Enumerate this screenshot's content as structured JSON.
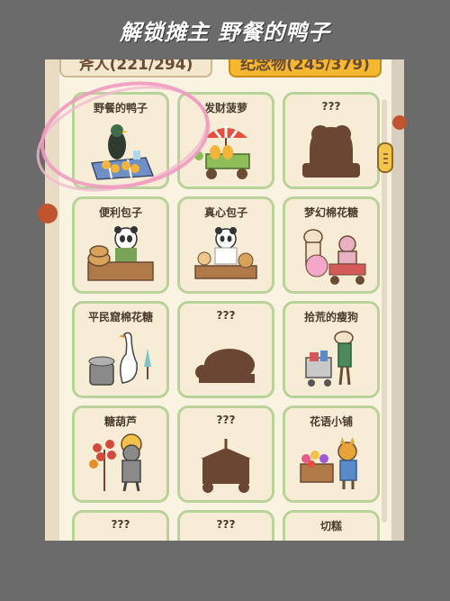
{
  "banner": {
    "title": "解锁摊主 野餐的鸭子"
  },
  "tabs": {
    "stalls": "斧人(221/294)",
    "souvenirs": "纪念物(245/379)"
  },
  "cards": [
    {
      "title": "野餐的鸭子",
      "icon": "duck-picnic-icon",
      "locked": false
    },
    {
      "title": "发财菠萝",
      "icon": "pineapple-cart-icon",
      "locked": false
    },
    {
      "title": "???",
      "icon": "locked-silhouette-icon",
      "locked": true
    },
    {
      "title": "便利包子",
      "icon": "panda-bun-stall-icon",
      "locked": false
    },
    {
      "title": "真心包子",
      "icon": "panda-baker-icon",
      "locked": false
    },
    {
      "title": "梦幻棉花糖",
      "icon": "cotton-candy-dogs-icon",
      "locked": false
    },
    {
      "title": "平民窟棉花糖",
      "icon": "goose-cotton-candy-icon",
      "locked": false
    },
    {
      "title": "???",
      "icon": "locked-silhouette-icon",
      "locked": true
    },
    {
      "title": "拾荒的瘦狗",
      "icon": "scavenger-dog-icon",
      "locked": false
    },
    {
      "title": "糖葫芦",
      "icon": "candied-haws-raccoon-icon",
      "locked": false
    },
    {
      "title": "???",
      "icon": "locked-silhouette-icon",
      "locked": true
    },
    {
      "title": "花语小铺",
      "icon": "flower-shop-icon",
      "locked": false
    },
    {
      "title": "???",
      "icon": "locked-silhouette-icon",
      "locked": true
    },
    {
      "title": "???",
      "icon": "locked-silhouette-icon",
      "locked": true
    },
    {
      "title": "切糕",
      "icon": "nut-cake-icon",
      "locked": false
    }
  ],
  "colors": {
    "card_border": "#b9d29a",
    "card_bg": "#f7edd6",
    "silhouette": "#6b4632",
    "highlight_circle": "#f09ac0",
    "souvenir_tab": "#f5b830"
  }
}
